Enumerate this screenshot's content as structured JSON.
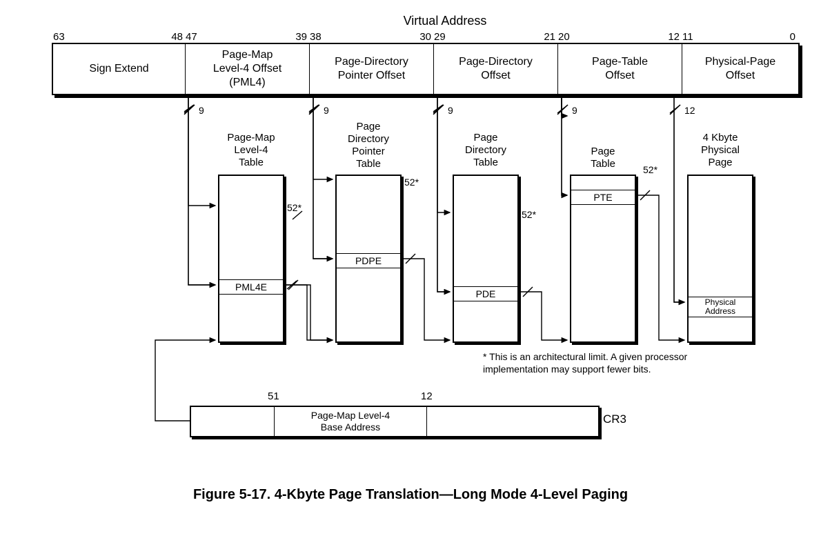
{
  "title_top": "Virtual Address",
  "bits": {
    "b63": "63",
    "b48": "48",
    "b47": "47",
    "b39": "39",
    "b38": "38",
    "b30": "30",
    "b29": "29",
    "b21": "21",
    "b20": "20",
    "b12": "12",
    "b11": "11",
    "b0": "0"
  },
  "va_fields": {
    "sign_extend": "Sign Extend",
    "pml4": "Page-Map\nLevel-4 Offset\n(PML4)",
    "pdpo": "Page-Directory\nPointer Offset",
    "pdo": "Page-Directory\nOffset",
    "pto": "Page-Table\nOffset",
    "ppo": "Physical-Page\nOffset"
  },
  "bus_widths": {
    "nine": "9",
    "twelve": "12",
    "fifty_two_star": "52*"
  },
  "tables": {
    "pml4": {
      "title": "Page-Map\nLevel-4\nTable",
      "entry": "PML4E"
    },
    "pdpt": {
      "title": "Page\nDirectory\nPointer\nTable",
      "entry": "PDPE"
    },
    "pdt": {
      "title": "Page\nDirectory\nTable",
      "entry": "PDE"
    },
    "pt": {
      "title": "Page\nTable",
      "entry": "PTE"
    },
    "page": {
      "title": "4 Kbyte\nPhysical\nPage",
      "entry": "Physical\nAddress"
    }
  },
  "cr3": {
    "b51": "51",
    "b12": "12",
    "center": "Page-Map Level-4\nBase Address",
    "label": "CR3"
  },
  "footnote": "* This is an architectural limit. A given processor implementation may support fewer bits.",
  "caption": "Figure 5-17.   4-Kbyte Page Translation—Long Mode 4-Level Paging"
}
